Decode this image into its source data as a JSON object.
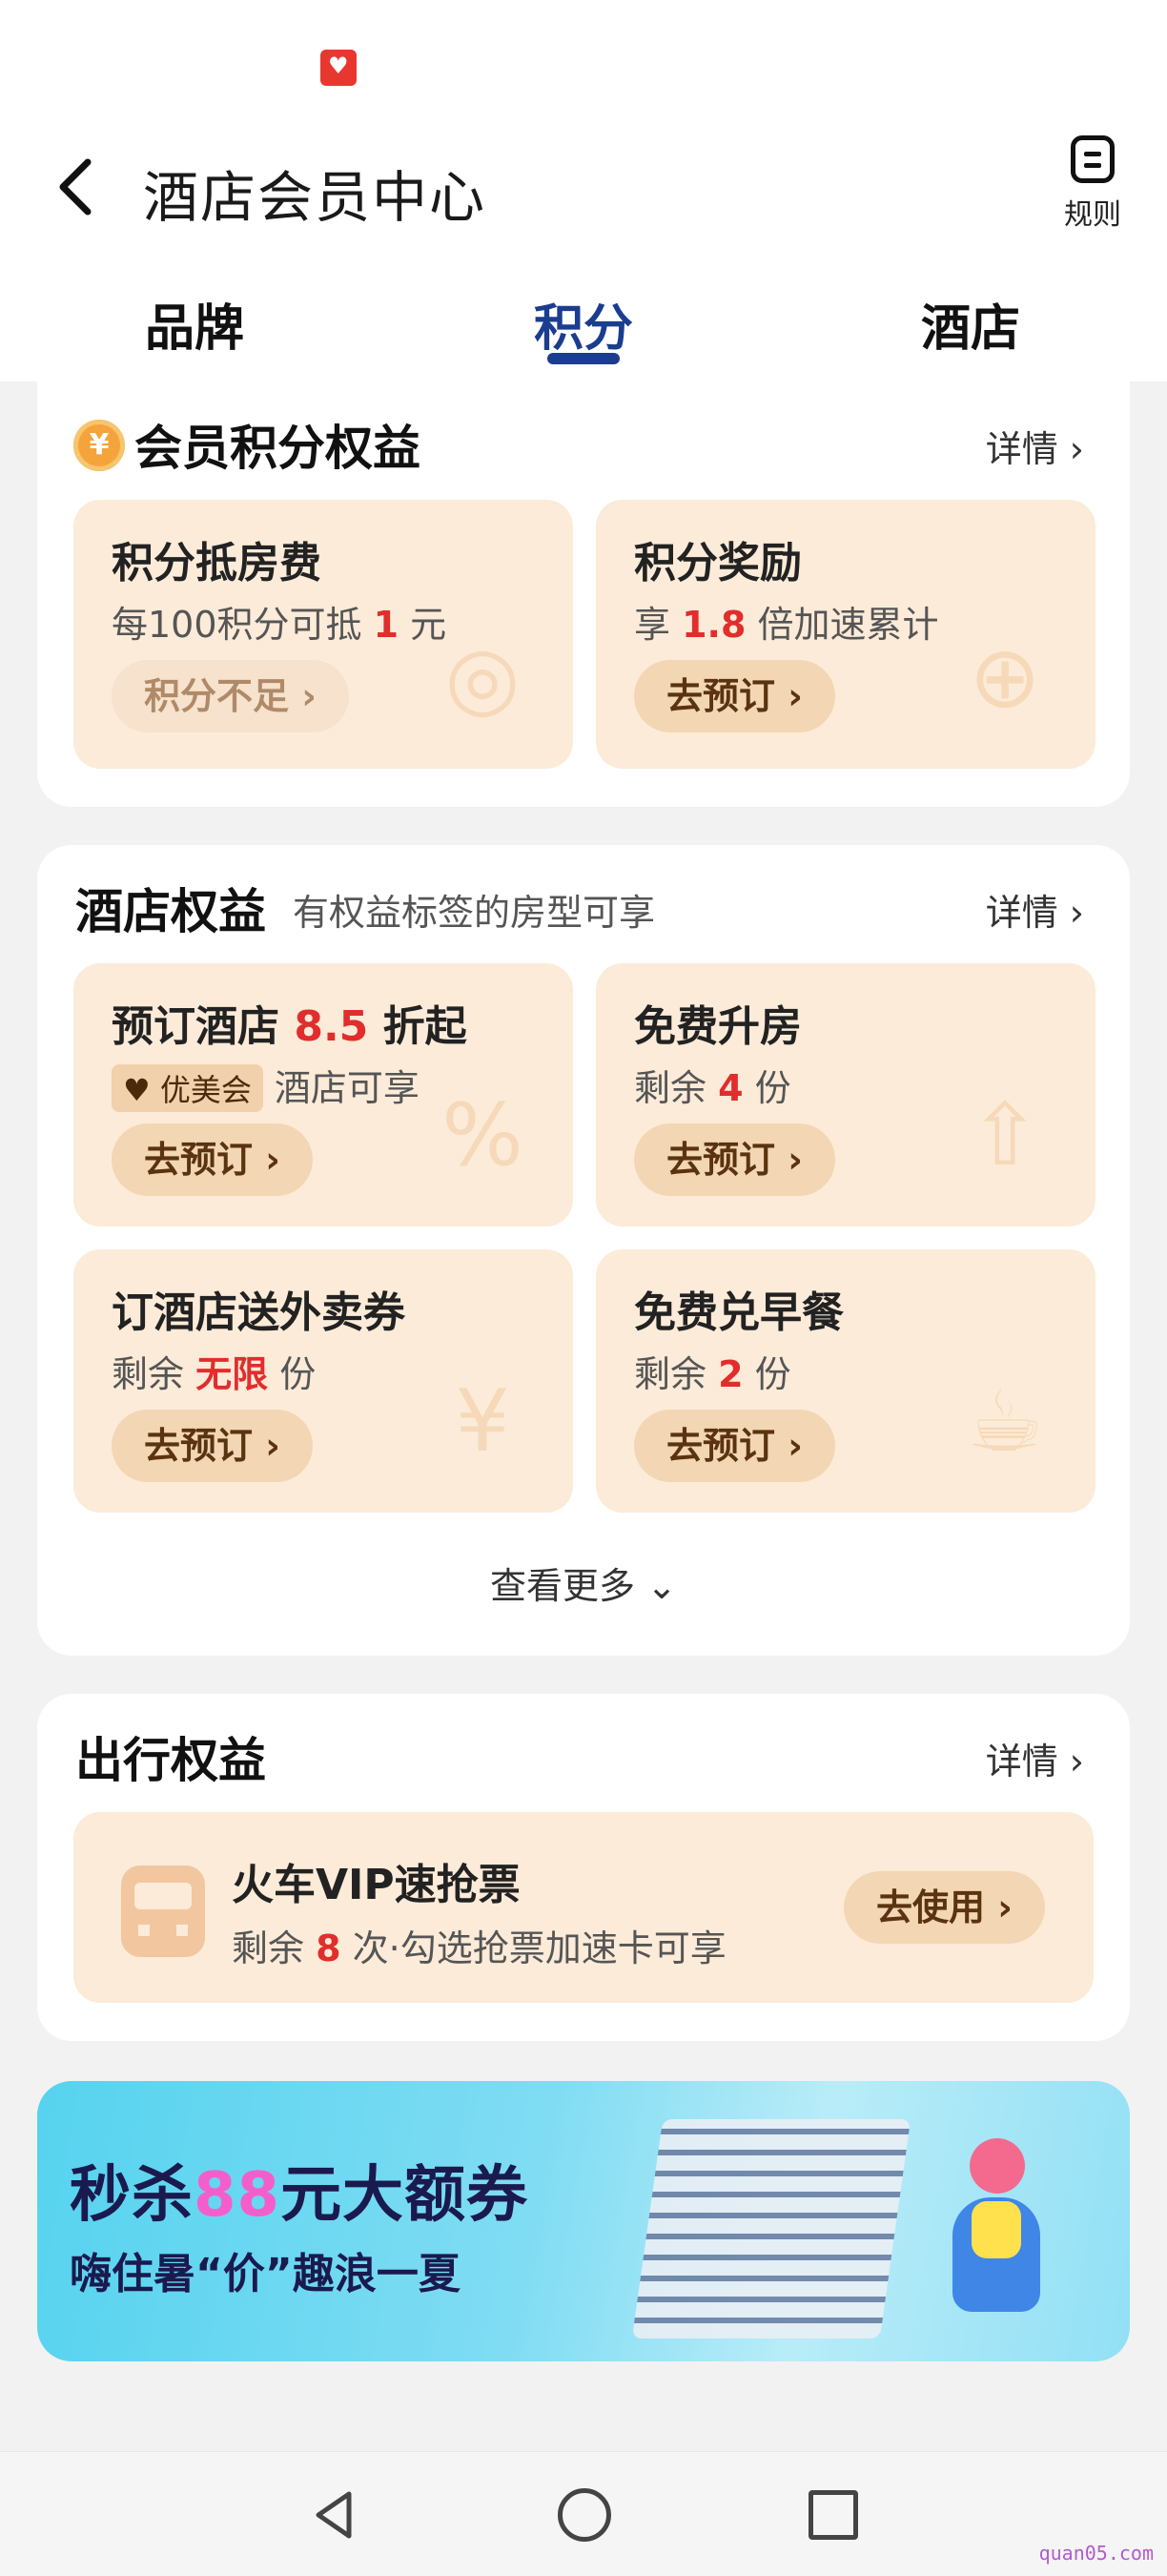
{
  "header": {
    "title": "酒店会员中心",
    "rules_label": "规则",
    "tabs": [
      {
        "label": "品牌",
        "active": false
      },
      {
        "label": "积分",
        "active": true
      },
      {
        "label": "酒店",
        "active": false
      }
    ]
  },
  "points_section": {
    "coin_glyph": "¥",
    "title": "会员积分权益",
    "detail": "详情",
    "tiles": [
      {
        "title": "积分抵房费",
        "desc_prefix": "每100积分可抵 ",
        "desc_value": "1",
        "desc_suffix": " 元",
        "button": "积分不足",
        "button_disabled": true,
        "icon": "coin-stack-icon"
      },
      {
        "title": "积分奖励",
        "desc_prefix": "享 ",
        "desc_value": "1.8",
        "desc_suffix": " 倍加速累计",
        "button": "去预订",
        "button_disabled": false,
        "icon": "coin-up-icon"
      }
    ]
  },
  "hotel_section": {
    "title": "酒店权益",
    "subtitle": "有权益标签的房型可享",
    "detail": "详情",
    "tiles": [
      {
        "title_prefix": "预订酒店 ",
        "title_value": "8.5",
        "title_suffix": " 折起",
        "badge": "优美会",
        "desc": "酒店可享",
        "button": "去预订",
        "icon": "discount-tag-icon"
      },
      {
        "title": "免费升房",
        "desc_prefix": "剩余 ",
        "desc_value": "4",
        "desc_suffix": " 份",
        "button": "去预订",
        "icon": "room-upgrade-icon"
      },
      {
        "title": "订酒店送外卖券",
        "desc_prefix": "剩余 ",
        "desc_value": "无限",
        "desc_suffix": " 份",
        "button": "去预订",
        "icon": "coupon-icon"
      },
      {
        "title": "免费兑早餐",
        "desc_prefix": "剩余 ",
        "desc_value": "2",
        "desc_suffix": " 份",
        "button": "去预订",
        "icon": "breakfast-icon"
      }
    ],
    "more": "查看更多"
  },
  "travel_section": {
    "title": "出行权益",
    "detail": "详情",
    "item": {
      "title": "火车VIP速抢票",
      "desc_prefix": "剩余 ",
      "desc_value": "8",
      "desc_suffix": " 次·勾选抢票加速卡可享",
      "button": "去使用"
    }
  },
  "banner": {
    "line1_prefix": "秒杀",
    "line1_highlight": "88",
    "line1_suffix": "元大额券",
    "line2": "嗨住暑“价”趣浪一夏"
  },
  "watermark": "quan05.com",
  "colors": {
    "accent_blue": "#1b3d8f",
    "highlight_red": "#e22d2d",
    "tile_bg": "#fcebd8",
    "button_bg": "#f3d6b3"
  }
}
